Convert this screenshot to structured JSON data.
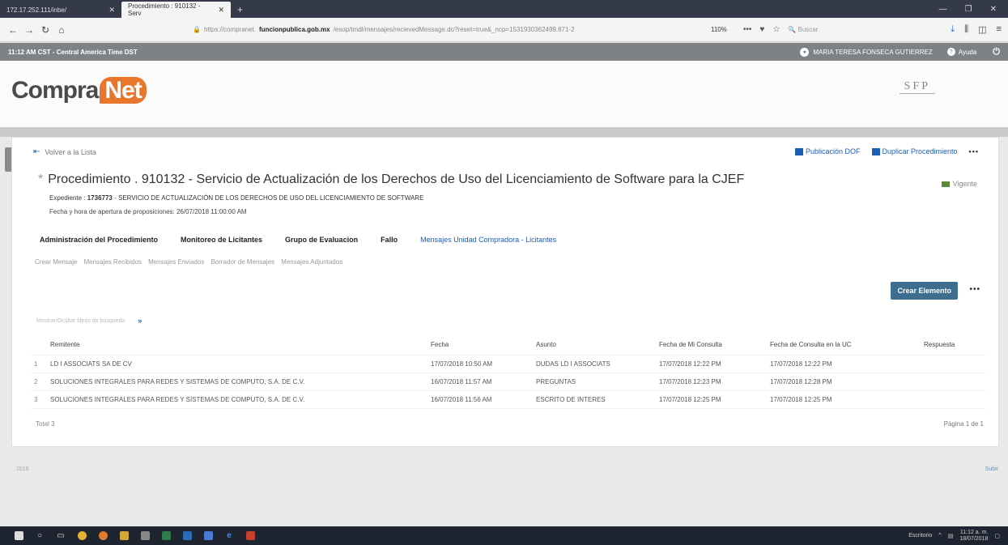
{
  "browser": {
    "tabs": [
      {
        "title": "172.17.252.111/inbe/"
      },
      {
        "title": "Procedimiento : 910132 - Serv"
      }
    ],
    "url_prefix": "https://compranet.",
    "url_host": "funcionpublica.gob.mx",
    "url_rest": "/esop/tmdl/mensajes/recievedMessage.do?reset=true&_ncp=1531930362499.871-2",
    "zoom": "110%",
    "search_placeholder": "Buscar"
  },
  "appbar": {
    "time": "11:12 AM CST - Central America Time DST",
    "user": "MARIA TERESA FONSECA GUTIERREZ",
    "help": "Ayuda"
  },
  "header": {
    "logo_main": "Compra",
    "logo_accent": "Net",
    "sfp": "SFP"
  },
  "page": {
    "back": "Volver a la Lista",
    "actions": {
      "publication": "Publicación DOF",
      "duplicate": "Duplicar Procedimiento",
      "more": "•••"
    },
    "title": "Procedimiento . 910132 - Servicio de Actualización de los Derechos de Uso del Licenciamiento de Software para la CJEF",
    "status": "Vigente",
    "expediente_label": "Expediente :",
    "expediente_num": "1736773",
    "expediente_desc": "- SERVICIO DE ACTUALIZACIÓN DE LOS DERECHOS DE USO DEL LICENCIAMIENTO DE SOFTWARE",
    "fecha_apertura": "Fecha y hora de apertura de proposiciones: 26/07/2018 11:00:00 AM"
  },
  "main_tabs": [
    {
      "label": "Administración del Procedimiento"
    },
    {
      "label": "Monitoreo de Licitantes"
    },
    {
      "label": "Grupo de Evaluacion"
    },
    {
      "label": "Fallo"
    },
    {
      "label": "Mensajes Unidad Compradora - Licitantes"
    }
  ],
  "sub_tabs": [
    {
      "label": "Crear Mensaje"
    },
    {
      "label": "Mensajes Recibidos"
    },
    {
      "label": "Mensajes Enviados"
    },
    {
      "label": "Borrador de Mensajes"
    },
    {
      "label": "Mensajes Adjuntados"
    }
  ],
  "create_button": "Crear Elemento",
  "filter_hint": "Mostrar/Ocultar filtros de búsqueda",
  "table": {
    "headers": [
      "Remitente",
      "Fecha",
      "Asunto",
      "Fecha de Mi Consulta",
      "Fecha de Consulta en la UC",
      "Respuesta"
    ],
    "rows": [
      {
        "idx": "1",
        "remitente": "LD I ASSOCIATS SA DE CV",
        "fecha": "17/07/2018 10:50 AM",
        "asunto": "DUDAS LD I ASSOCIATS",
        "mi_consulta": "17/07/2018 12:22 PM",
        "consulta_uc": "17/07/2018 12:22 PM",
        "respuesta": ""
      },
      {
        "idx": "2",
        "remitente": "SOLUCIONES INTEGRALES PARA REDES Y SISTEMAS DE COMPUTO, S.A. DE C.V.",
        "fecha": "16/07/2018 11:57 AM",
        "asunto": "PREGUNTAS",
        "mi_consulta": "17/07/2018 12:23 PM",
        "consulta_uc": "17/07/2018 12:28 PM",
        "respuesta": ""
      },
      {
        "idx": "3",
        "remitente": "SOLUCIONES INTEGRALES PARA REDES Y SISTEMAS DE COMPUTO, S.A. DE C.V.",
        "fecha": "16/07/2018 11:56 AM",
        "asunto": "ESCRITO DE INTERES",
        "mi_consulta": "17/07/2018 12:25 PM",
        "consulta_uc": "17/07/2018 12:25 PM",
        "respuesta": ""
      }
    ]
  },
  "total": "Total 3",
  "pagination": "Página 1 de 1",
  "footer": {
    "left": "2018",
    "right": "Subir"
  },
  "taskbar": {
    "tray_label": "Escritorio",
    "time": "11:12 a. m.",
    "date": "18/07/2018"
  }
}
